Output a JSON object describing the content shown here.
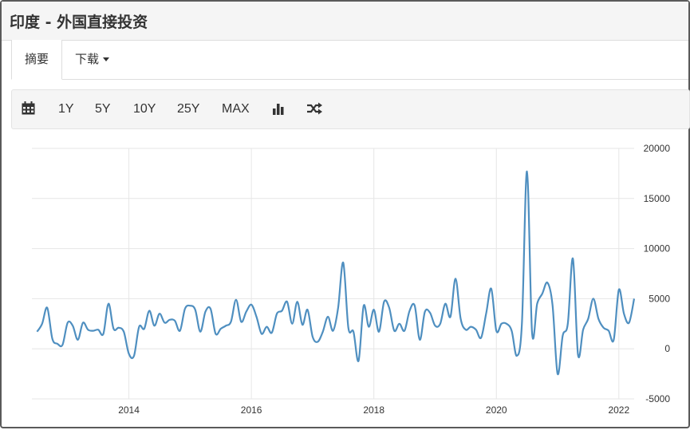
{
  "header": {
    "title": "印度 - 外国直接投资"
  },
  "tabs": [
    {
      "label": "摘要"
    },
    {
      "label": "下载"
    }
  ],
  "toolbar": {
    "icons": [
      "calendar-icon",
      "bar-chart-icon",
      "shuffle-icon"
    ],
    "ranges": [
      "1Y",
      "5Y",
      "10Y",
      "25Y",
      "MAX"
    ]
  },
  "colors": {
    "line": "#4f8fc0",
    "grid": "#e6e6e6",
    "header_bg": "#f5f5f5"
  },
  "chart_data": {
    "type": "line",
    "title": "",
    "xlabel": "",
    "ylabel": "",
    "x_ticks": [
      "2014",
      "2016",
      "2018",
      "2020",
      "2022"
    ],
    "y_ticks": [
      20000,
      15000,
      10000,
      5000,
      0,
      -5000
    ],
    "y_tick_labels": [
      "20000",
      "15000",
      "10000",
      "5000",
      "0",
      "-5000"
    ],
    "ylim": [
      -5000,
      20000
    ],
    "xlim": [
      "2012-06",
      "2022-04"
    ],
    "grid": true,
    "legend": "none",
    "series": [
      {
        "name": "",
        "x": [
          "2012-07",
          "2012-08",
          "2012-09",
          "2012-10",
          "2012-11",
          "2012-12",
          "2013-01",
          "2013-02",
          "2013-03",
          "2013-04",
          "2013-05",
          "2013-06",
          "2013-07",
          "2013-08",
          "2013-09",
          "2013-10",
          "2013-11",
          "2013-12",
          "2014-01",
          "2014-02",
          "2014-03",
          "2014-04",
          "2014-05",
          "2014-06",
          "2014-07",
          "2014-08",
          "2014-09",
          "2014-10",
          "2014-11",
          "2014-12",
          "2015-01",
          "2015-02",
          "2015-03",
          "2015-04",
          "2015-05",
          "2015-06",
          "2015-07",
          "2015-08",
          "2015-09",
          "2015-10",
          "2015-11",
          "2015-12",
          "2016-01",
          "2016-02",
          "2016-03",
          "2016-04",
          "2016-05",
          "2016-06",
          "2016-07",
          "2016-08",
          "2016-09",
          "2016-10",
          "2016-11",
          "2016-12",
          "2017-01",
          "2017-02",
          "2017-03",
          "2017-04",
          "2017-05",
          "2017-06",
          "2017-07",
          "2017-08",
          "2017-09",
          "2017-10",
          "2017-11",
          "2017-12",
          "2018-01",
          "2018-02",
          "2018-03",
          "2018-04",
          "2018-05",
          "2018-06",
          "2018-07",
          "2018-08",
          "2018-09",
          "2018-10",
          "2018-11",
          "2018-12",
          "2019-01",
          "2019-02",
          "2019-03",
          "2019-04",
          "2019-05",
          "2019-06",
          "2019-07",
          "2019-08",
          "2019-09",
          "2019-10",
          "2019-11",
          "2019-12",
          "2020-01",
          "2020-02",
          "2020-03",
          "2020-04",
          "2020-05",
          "2020-06",
          "2020-07",
          "2020-08",
          "2020-09",
          "2020-10",
          "2020-11",
          "2020-12",
          "2021-01",
          "2021-02",
          "2021-03",
          "2021-04",
          "2021-05",
          "2021-06",
          "2021-07",
          "2021-08",
          "2021-09",
          "2021-10",
          "2021-11",
          "2021-12",
          "2022-01",
          "2022-02",
          "2022-03",
          "2022-04"
        ],
        "values": [
          1700,
          2500,
          4100,
          1000,
          500,
          400,
          2600,
          2300,
          900,
          2600,
          1900,
          1800,
          1900,
          1500,
          4500,
          2000,
          2100,
          1700,
          -500,
          -700,
          2200,
          2000,
          3800,
          2300,
          3500,
          2600,
          2900,
          2800,
          1800,
          4000,
          4300,
          3900,
          1700,
          3700,
          4000,
          1500,
          2000,
          2300,
          2700,
          4900,
          2700,
          3700,
          4400,
          3200,
          1500,
          2200,
          1600,
          3500,
          3800,
          4700,
          2500,
          4700,
          2400,
          3900,
          1200,
          700,
          1700,
          3200,
          1800,
          4100,
          8600,
          2100,
          1700,
          -1200,
          4300,
          2200,
          3900,
          1700,
          4700,
          4100,
          1800,
          2500,
          1800,
          3800,
          4300,
          900,
          3700,
          3600,
          2300,
          2500,
          4500,
          3200,
          7000,
          3000,
          1900,
          2200,
          1900,
          1100,
          3500,
          6000,
          1800,
          2500,
          2500,
          1800,
          -700,
          2400,
          17700,
          1600,
          4500,
          5500,
          6600,
          4400,
          -2500,
          1300,
          2500,
          9000,
          -600,
          1900,
          3000,
          5000,
          3000,
          2100,
          1800,
          900,
          5900,
          3500,
          2600,
          5000
        ]
      }
    ]
  }
}
